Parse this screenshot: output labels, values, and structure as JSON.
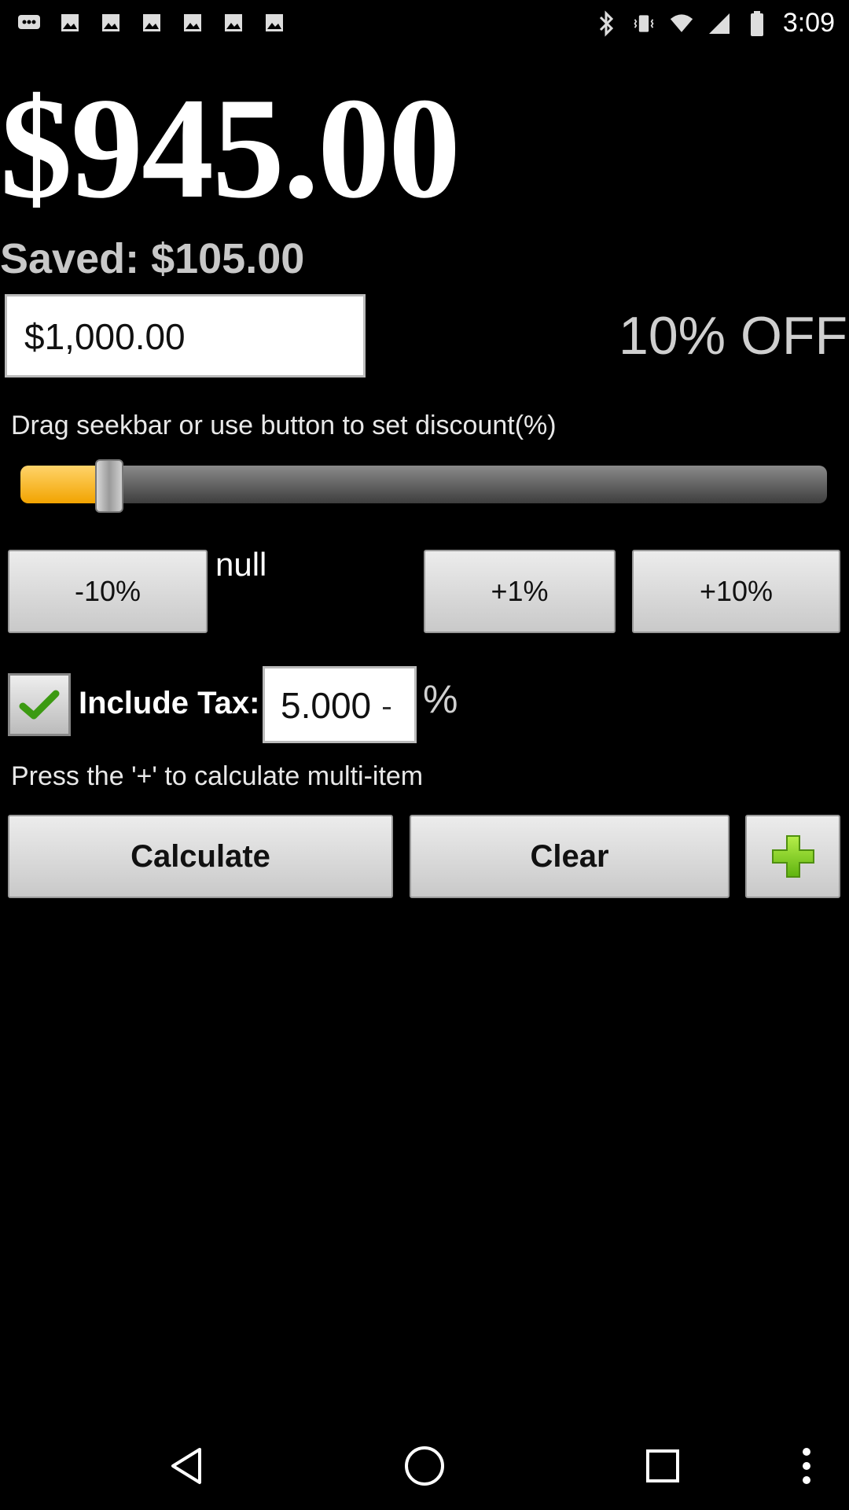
{
  "status_bar": {
    "time": "3:09",
    "left_icons": [
      "message-icon",
      "image-icon",
      "image-icon",
      "image-icon",
      "image-icon",
      "image-icon",
      "image-icon"
    ],
    "right_icons": [
      "bluetooth-icon",
      "vibrate-icon",
      "wifi-icon",
      "signal-icon",
      "battery-icon"
    ]
  },
  "result": {
    "total": "$945.00",
    "saved": "Saved: $105.00"
  },
  "price_input": {
    "value": "$1,000.00"
  },
  "discount_label": "10% OFF",
  "seek_hint": "Drag seekbar or use button to set discount(%)",
  "seekbar": {
    "value_percent": 10,
    "max_percent": 100,
    "accent": "#f2a400"
  },
  "buttons": {
    "minus10": "-10%",
    "null_label": "null",
    "plus1": "+1%",
    "plus10": "+10%",
    "calculate": "Calculate",
    "clear": "Clear"
  },
  "tax": {
    "checked": true,
    "label": "Include Tax:",
    "value": "5.000",
    "unit": "%"
  },
  "multi_hint": "Press the '+' to calculate multi-item",
  "add_icon": "plus-icon",
  "nav_bar": [
    "back-icon",
    "home-icon",
    "recents-icon",
    "menu-icon"
  ]
}
